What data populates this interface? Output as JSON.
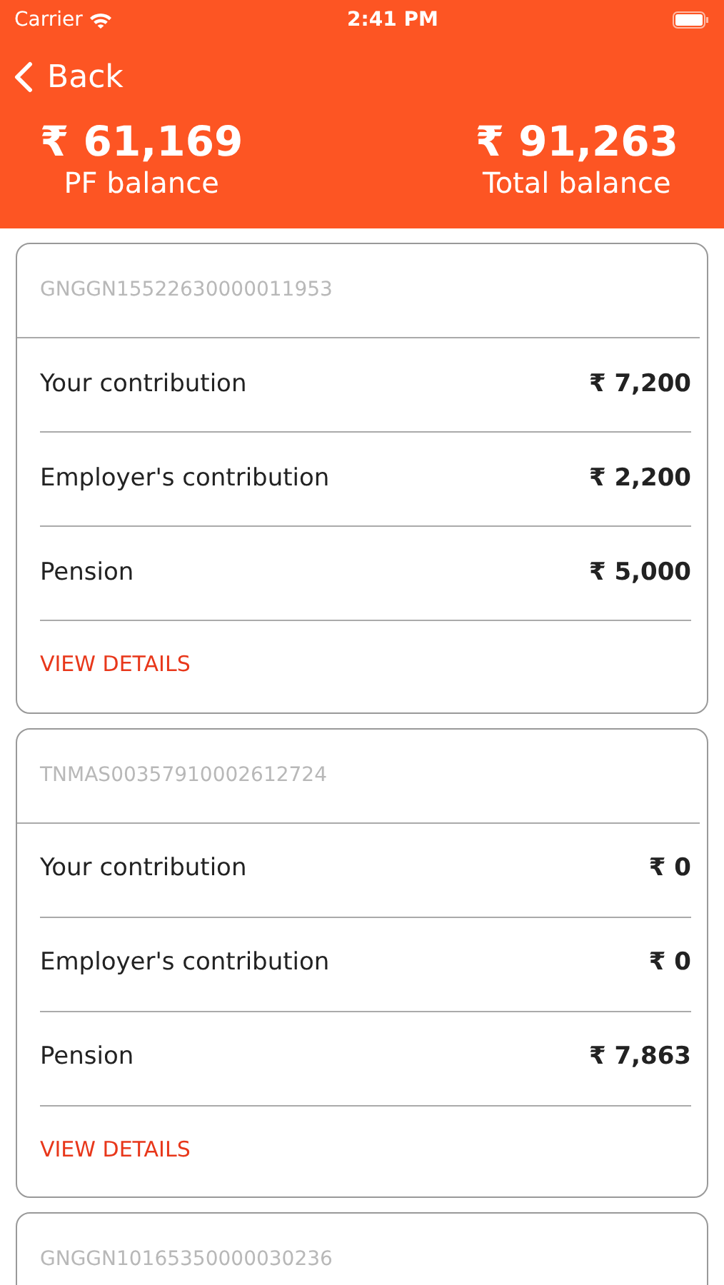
{
  "status_bar": {
    "carrier": "Carrier",
    "time": "2:41 PM"
  },
  "nav": {
    "back": "Back"
  },
  "balances": [
    {
      "amount": "₹ 61,169",
      "label": "PF balance"
    },
    {
      "amount": "₹ 91,263",
      "label": "Total balance"
    }
  ],
  "accounts": [
    {
      "number": "GNGGN15522630000011953",
      "rows": [
        {
          "label": "Your contribution",
          "value": "₹ 7,200"
        },
        {
          "label": "Employer's contribution",
          "value": "₹ 2,200"
        },
        {
          "label": "Pension",
          "value": "₹ 5,000"
        }
      ],
      "action": "VIEW DETAILS"
    },
    {
      "number": "TNMAS00357910002612724",
      "rows": [
        {
          "label": "Your contribution",
          "value": "₹ 0"
        },
        {
          "label": "Employer's contribution",
          "value": "₹ 0"
        },
        {
          "label": "Pension",
          "value": "₹ 7,863"
        }
      ],
      "action": "VIEW DETAILS"
    },
    {
      "number": "GNGGN10165350000030236"
    }
  ]
}
